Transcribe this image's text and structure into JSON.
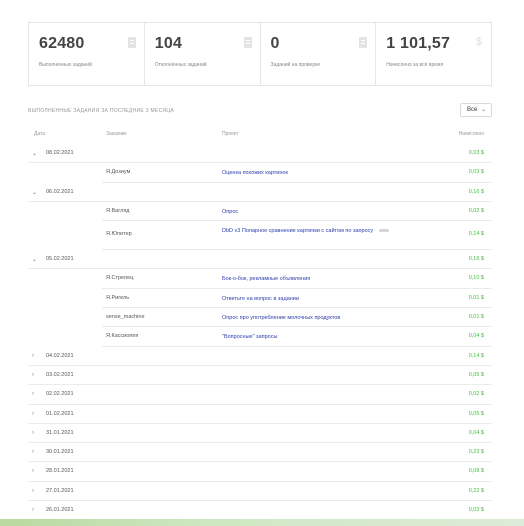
{
  "stats": [
    {
      "value": "62480",
      "label": "Выполненных заданий",
      "icon": "document-icon"
    },
    {
      "value": "104",
      "label": "Отклонённых заданий",
      "icon": "document-icon"
    },
    {
      "value": "0",
      "label": "Заданий на проверке",
      "icon": "document-icon"
    },
    {
      "value": "1 101,57",
      "label": "Начислено за всё время",
      "icon": "dollar-icon"
    }
  ],
  "section_title": "Выполненные задания за последние 3 месяца",
  "period_select": {
    "value": "Все"
  },
  "columns": {
    "date": "Дата",
    "customer": "Заказчик",
    "project": "Проект",
    "amount": "Начислено"
  },
  "rows": [
    {
      "kind": "date",
      "expanded": true,
      "date": "08.02.2021",
      "amount": "0,03 $"
    },
    {
      "kind": "task",
      "worker": "Я.Дозиум",
      "project": "Оценка похожих картинок",
      "amount": "0,03 $"
    },
    {
      "kind": "date",
      "expanded": true,
      "date": "06.02.2021",
      "amount": "0,16 $"
    },
    {
      "kind": "task",
      "worker": "Я.Вагляд",
      "project": "Опрос",
      "amount": "0,02 $"
    },
    {
      "kind": "task",
      "tall": true,
      "worker": "Я.Юпитер",
      "project": "DbD v3 Попарное сравнение картинки с сайтом по запросу",
      "amount": "0,14 $"
    },
    {
      "kind": "date",
      "expanded": true,
      "date": "05.02.2021",
      "amount": "0,16 $"
    },
    {
      "kind": "task",
      "worker": "Я.Стрелец",
      "project": "Бок-о-бок, рекламные объявления",
      "amount": "0,10 $"
    },
    {
      "kind": "task",
      "worker": "Я.Ригель",
      "project": "Ответьте на вопрос в задании",
      "amount": "0,01 $"
    },
    {
      "kind": "task",
      "worker": "sense_machine",
      "project": "Опрос про употребление молочных продуктов",
      "amount": "0,01 $"
    },
    {
      "kind": "task",
      "worker": "Я.Кассиопея",
      "project": "\"Вопросные\" запросы",
      "amount": "0,04 $"
    },
    {
      "kind": "date",
      "expanded": false,
      "date": "04.02.2021",
      "amount": "0,14 $"
    },
    {
      "kind": "date",
      "expanded": false,
      "date": "03.02.2021",
      "amount": "0,05 $"
    },
    {
      "kind": "date",
      "expanded": false,
      "date": "02.02.2021",
      "amount": "0,02 $"
    },
    {
      "kind": "date",
      "expanded": false,
      "date": "01.02.2021",
      "amount": "0,05 $"
    },
    {
      "kind": "date",
      "expanded": false,
      "date": "31.01.2021",
      "amount": "0,04 $"
    },
    {
      "kind": "date",
      "expanded": false,
      "date": "30.01.2021",
      "amount": "0,23 $"
    },
    {
      "kind": "date",
      "expanded": false,
      "date": "28.01.2021",
      "amount": "0,08 $"
    },
    {
      "kind": "date",
      "expanded": false,
      "date": "27.01.2021",
      "amount": "0,22 $"
    },
    {
      "kind": "date",
      "expanded": false,
      "date": "26.01.2021",
      "amount": "0,03 $"
    }
  ],
  "colors": {
    "link": "#2c3eaa",
    "amount": "#3fbf3f",
    "border": "#e6e6e6"
  }
}
